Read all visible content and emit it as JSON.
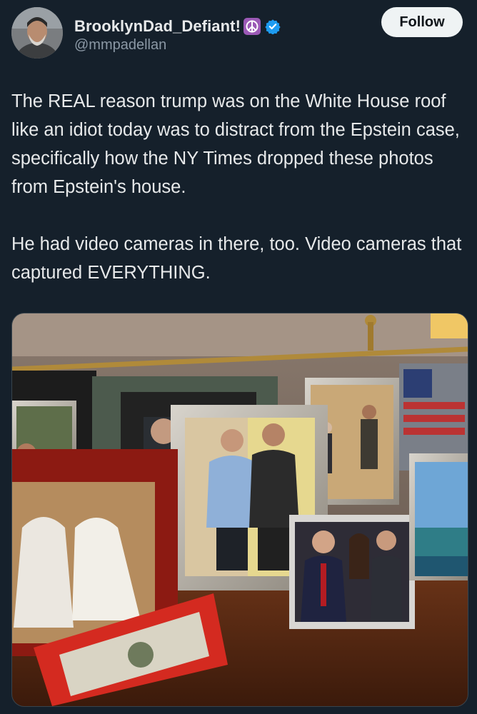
{
  "post": {
    "author": {
      "display_name": "BrooklynDad_Defiant!",
      "handle": "@mmpadellan",
      "emoji_icon": "peace-symbol-icon",
      "verified_icon": "verified-badge-icon"
    },
    "follow_label": "Follow",
    "text_paragraphs": [
      "The REAL reason trump was on the White House roof like an idiot today was to distract from the Epstein case, specifically how the NY Times dropped these photos from Epstein's house.",
      "He had video cameras in there, too. Video cameras that captured EVERYTHING."
    ],
    "media": {
      "description_icon": "photo-of-framed-pictures-icon"
    }
  },
  "colors": {
    "background": "#15202b",
    "text": "#e7e9ea",
    "secondary_text": "#8b98a5",
    "verified": "#1d9bf0",
    "peace_badge": "#9b59b6",
    "follow_bg": "#eff3f4"
  }
}
